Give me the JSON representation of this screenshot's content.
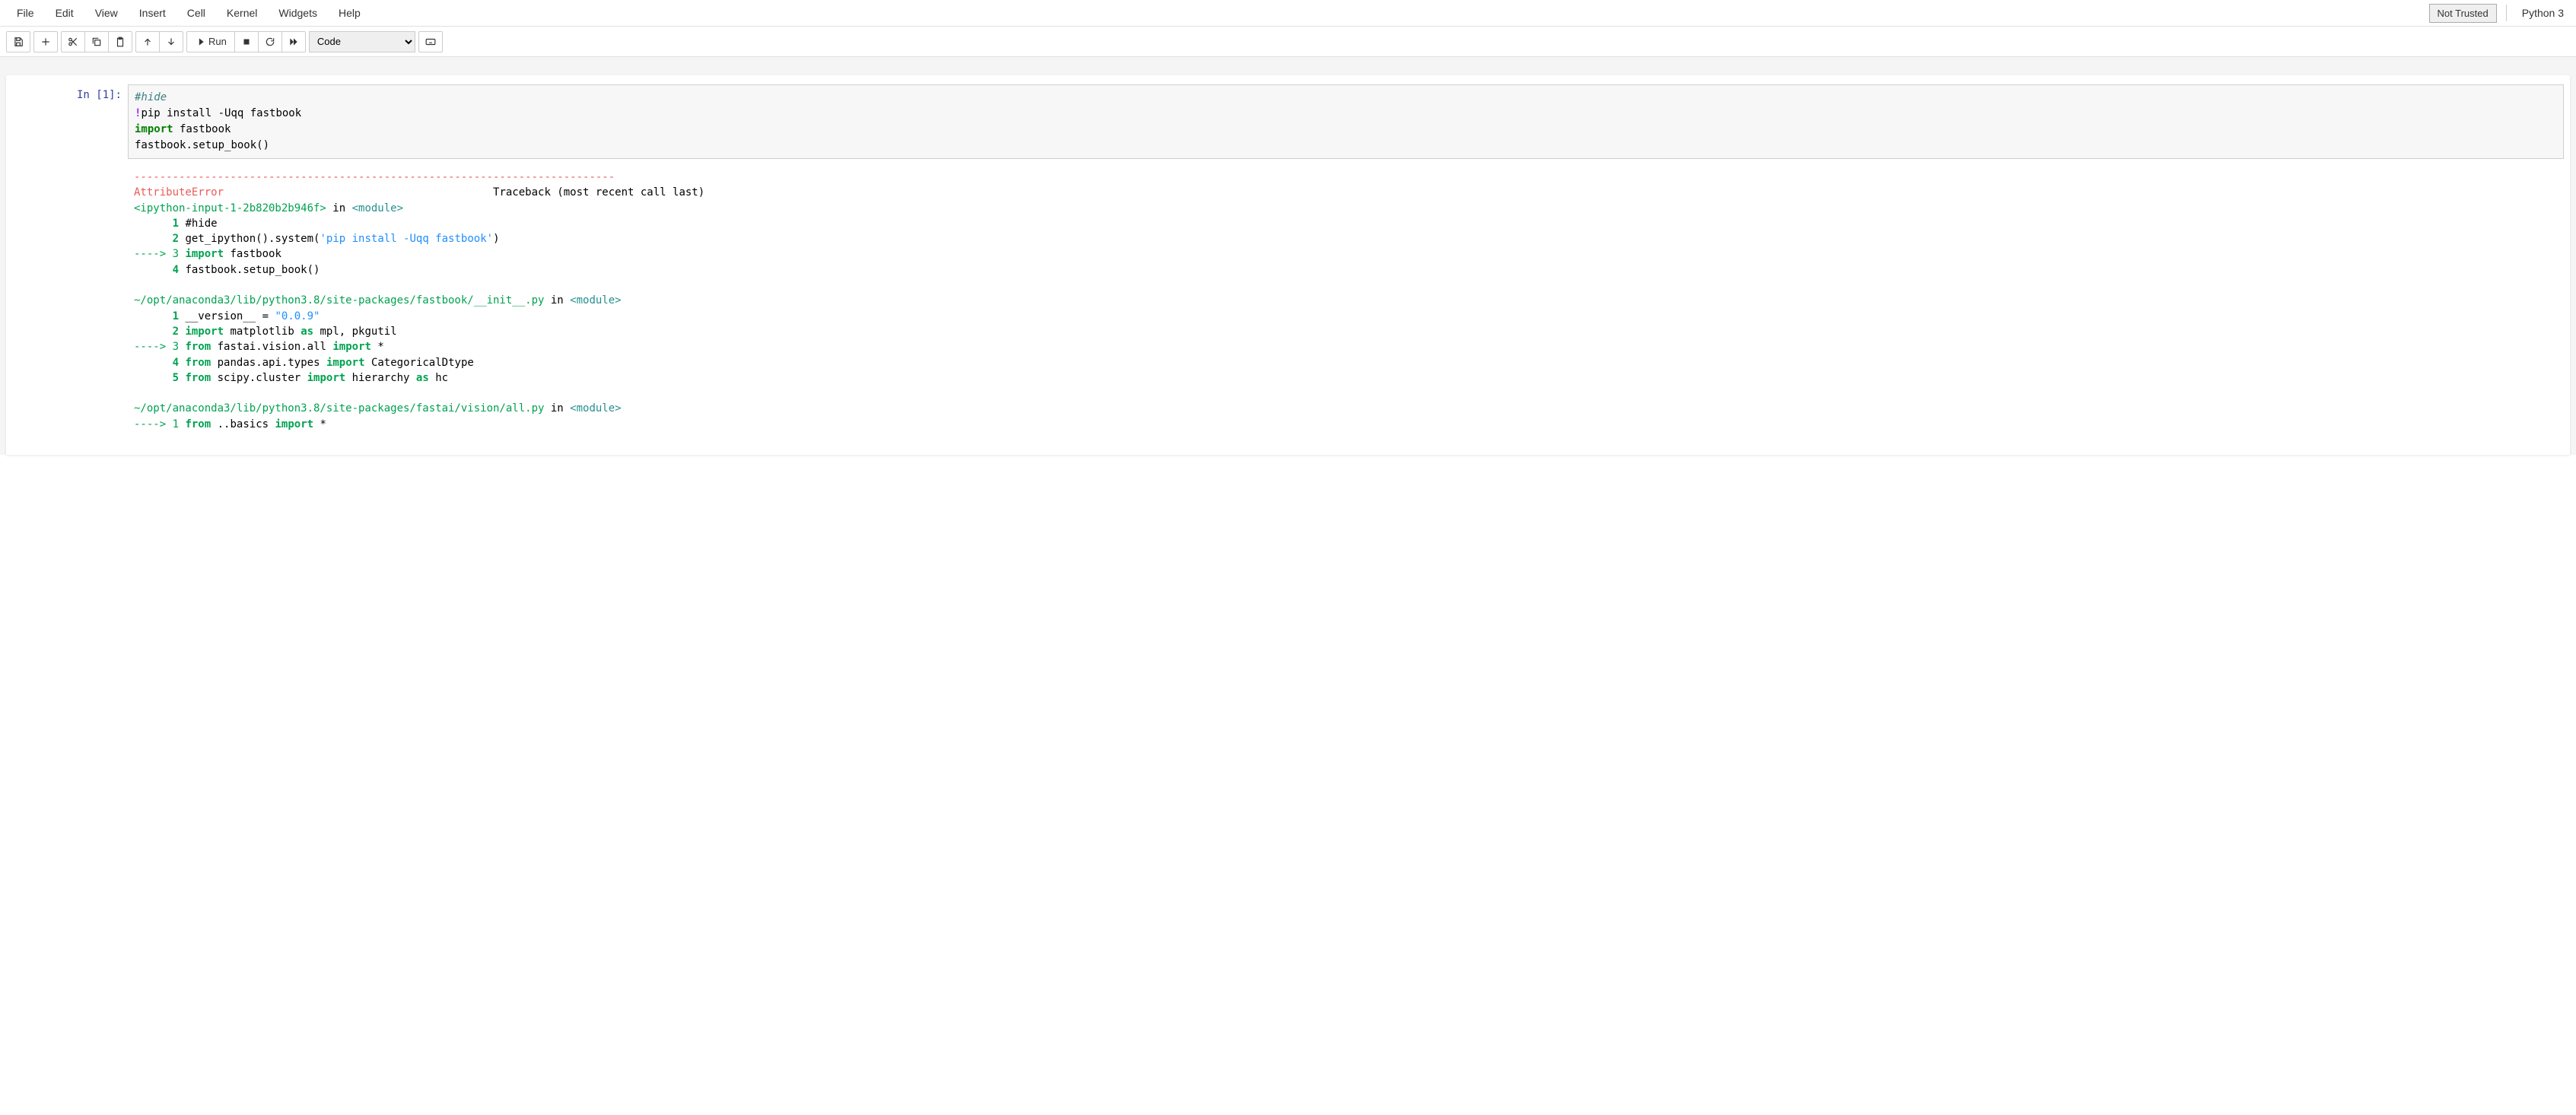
{
  "menu": {
    "file": "File",
    "edit": "Edit",
    "view": "View",
    "insert": "Insert",
    "cell": "Cell",
    "kernel": "Kernel",
    "widgets": "Widgets",
    "help": "Help"
  },
  "header": {
    "not_trusted": "Not Trusted",
    "kernel_name": "Python 3"
  },
  "toolbar": {
    "run_label": "Run",
    "cell_type_selected": "Code"
  },
  "cell1": {
    "prompt": "In [1]:",
    "code": {
      "comment": "#hide",
      "bang": "!",
      "pip_line": "pip install -Uqq fastbook",
      "import_kw": "import",
      "import_mod": " fastbook",
      "setup_line_a": "fastbook",
      "setup_line_b": ".",
      "setup_line_c": "setup_book",
      "setup_line_d": "()"
    }
  },
  "output": {
    "dashline": "---------------------------------------------------------------------------",
    "error_name": "AttributeError",
    "traceback_label": "                                          Traceback (most recent call last)",
    "frame1": {
      "loc": "<ipython-input-1-2b820b2b946f>",
      "in": " in ",
      "scope": "<module>",
      "l1_pre": "      1 ",
      "l1": "#hide",
      "l2_pre": "      2",
      "l2a": " get_ipython",
      "l2b": "()",
      "l2c": ".",
      "l2d": "system",
      "l2e": "(",
      "l2f": "'pip install -Uqq fastbook'",
      "l2g": ")",
      "l3_arrow": "----> 3",
      "l3a": " import",
      "l3b": " fastbook",
      "l4_pre": "      4",
      "l4a": " fastbook",
      "l4b": ".",
      "l4c": "setup_book",
      "l4d": "()"
    },
    "frame2": {
      "loc": "~/opt/anaconda3/lib/python3.8/site-packages/fastbook/__init__.py",
      "in": " in ",
      "scope": "<module>",
      "l1_pre": "      1",
      "l1a": " __version__ ",
      "l1b": "=",
      "l1c": " ",
      "l1d": "\"0.0.9\"",
      "l2_pre": "      2",
      "l2a": " import",
      "l2b": " matplotlib ",
      "l2c": "as",
      "l2d": " mpl",
      "l2e": ",",
      "l2f": " pkgutil",
      "l3_arrow": "----> 3",
      "l3a": " from",
      "l3b": " fastai",
      "l3c": ".",
      "l3d": "vision",
      "l3e": ".",
      "l3f": "all ",
      "l3g": "import",
      "l3h": " ",
      "l3i": "*",
      "l4_pre": "      4",
      "l4a": " from",
      "l4b": " pandas",
      "l4c": ".",
      "l4d": "api",
      "l4e": ".",
      "l4f": "types ",
      "l4g": "import",
      "l4h": " CategoricalDtype",
      "l5_pre": "      5",
      "l5a": " from",
      "l5b": " scipy",
      "l5c": ".",
      "l5d": "cluster ",
      "l5e": "import",
      "l5f": " hierarchy ",
      "l5g": "as",
      "l5h": " hc"
    },
    "frame3": {
      "loc": "~/opt/anaconda3/lib/python3.8/site-packages/fastai/vision/all.py",
      "in": " in ",
      "scope": "<module>",
      "l1_arrow": "----> 1",
      "l1a": " from",
      "l1b": " ",
      "l1c": ".",
      "l1d": ".",
      "l1e": "basics ",
      "l1f": "import",
      "l1g": " ",
      "l1h": "*"
    }
  }
}
